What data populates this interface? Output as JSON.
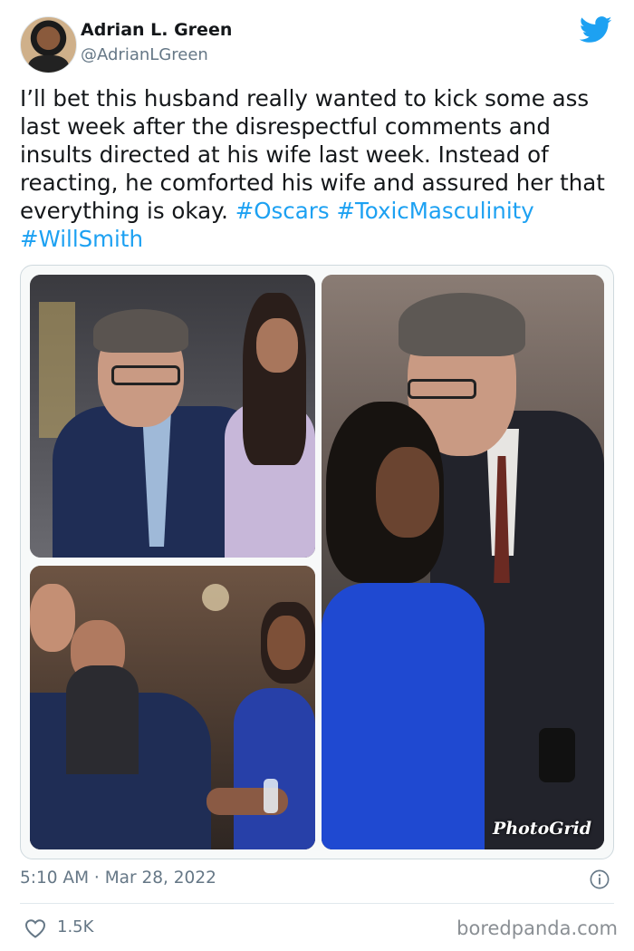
{
  "author": {
    "name": "Adrian L. Green",
    "handle": "@AdrianLGreen"
  },
  "icons": {
    "logo": "twitter-bird-icon",
    "info": "info-icon",
    "like": "heart-icon"
  },
  "colors": {
    "accent": "#1da1f2",
    "text": "#14171a",
    "muted": "#657786"
  },
  "tweet": {
    "text": "I’ll bet this husband really wanted to kick some ass last week after the disrespectful comments and insults directed at his wife last week.  Instead of reacting, he comforted his wife and assured her that everything is okay. ",
    "hashtags": [
      "#Oscars",
      "#ToxicMasculinity",
      "#WillSmith"
    ],
    "media": {
      "watermark": "PhotoGrid"
    },
    "time": "5:10 AM",
    "separator": " · ",
    "date": "Mar 28, 2022",
    "likes": "1.5K"
  },
  "footer": {
    "brand": "boredpanda.com"
  }
}
